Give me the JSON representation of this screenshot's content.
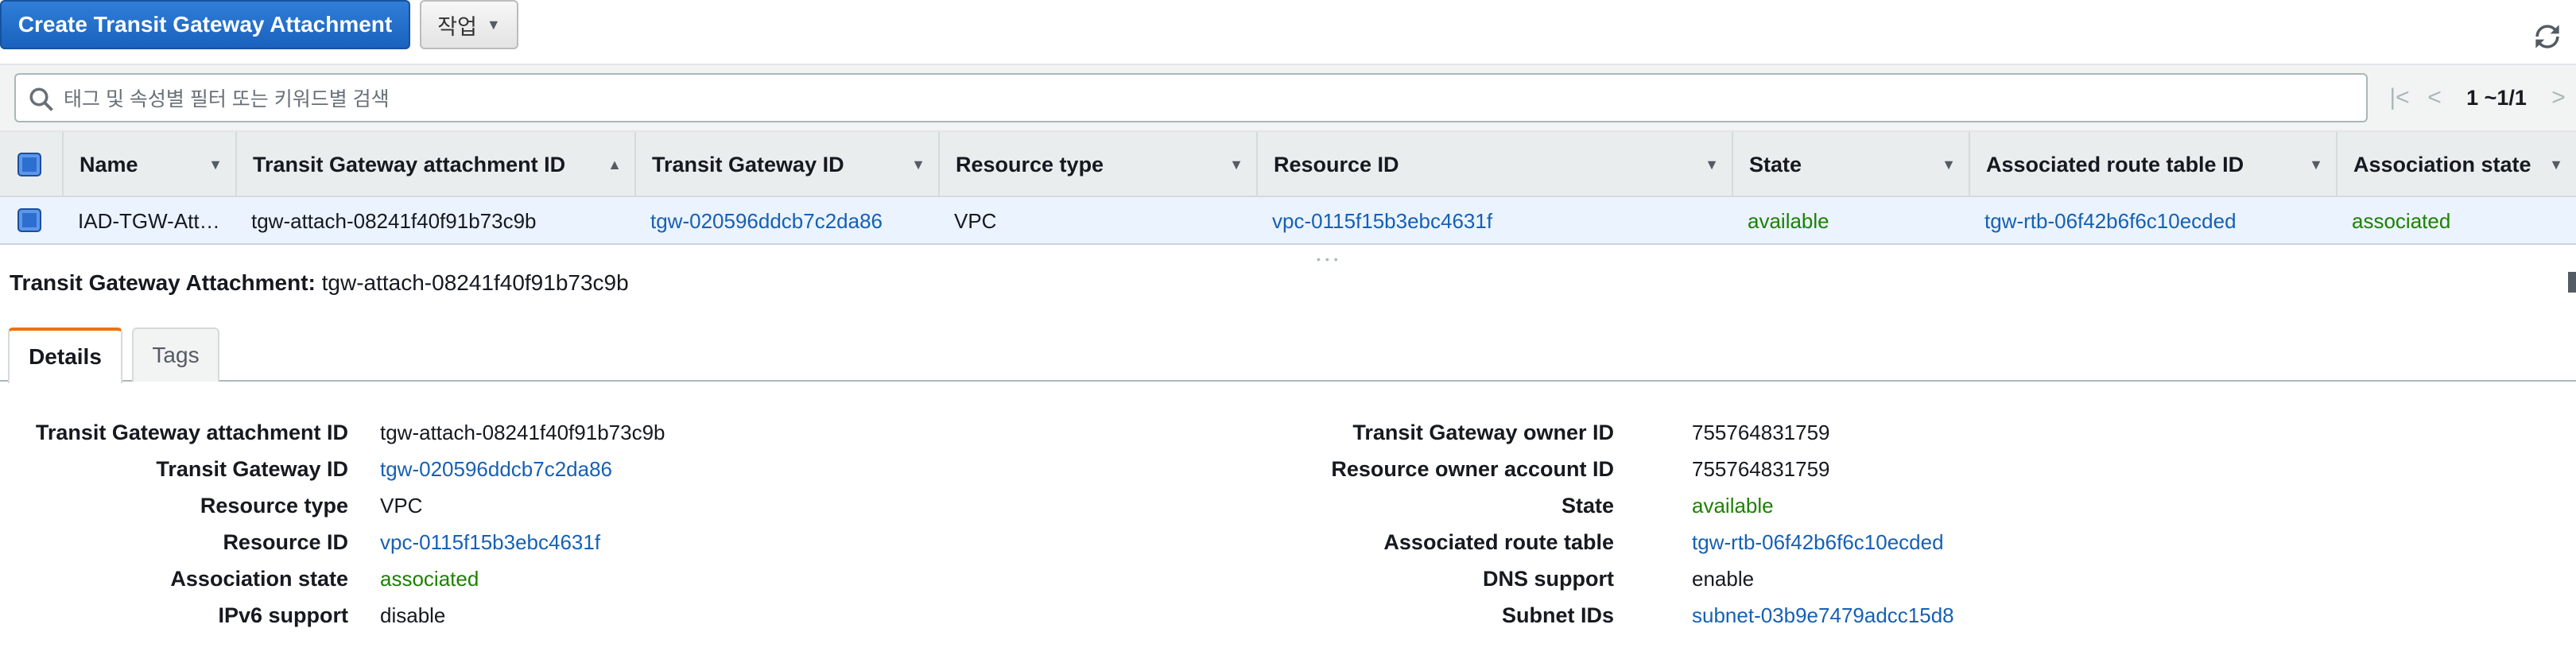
{
  "toolbar": {
    "create_button": "Create Transit Gateway Attachment",
    "actions_button": "작업"
  },
  "search": {
    "placeholder": "태그 및 속성별 필터 또는 키워드별 검색",
    "pagination": "1 ~1/1"
  },
  "table": {
    "columns": [
      "Name",
      "Transit Gateway attachment ID",
      "Transit Gateway ID",
      "Resource type",
      "Resource ID",
      "State",
      "Associated route table ID",
      "Association state"
    ],
    "rows": [
      {
        "name": "IAD-TGW-Att…",
        "attachment_id": "tgw-attach-08241f40f91b73c9b",
        "tgw_id": "tgw-020596ddcb7c2da86",
        "resource_type": "VPC",
        "resource_id": "vpc-0115f15b3ebc4631f",
        "state": "available",
        "route_table_id": "tgw-rtb-06f42b6f6c10ecded",
        "association_state": "associated"
      }
    ]
  },
  "detail": {
    "title_label": "Transit Gateway Attachment:",
    "title_value": "tgw-attach-08241f40f91b73c9b",
    "tabs": [
      "Details",
      "Tags"
    ],
    "left": [
      {
        "label": "Transit Gateway attachment ID",
        "value": "tgw-attach-08241f40f91b73c9b"
      },
      {
        "label": "Transit Gateway ID",
        "value": "tgw-020596ddcb7c2da86"
      },
      {
        "label": "Resource type",
        "value": "VPC"
      },
      {
        "label": "Resource ID",
        "value": "vpc-0115f15b3ebc4631f"
      },
      {
        "label": "Association state",
        "value": "associated"
      },
      {
        "label": "IPv6 support",
        "value": "disable"
      }
    ],
    "right": [
      {
        "label": "Transit Gateway owner ID",
        "value": "755764831759"
      },
      {
        "label": "Resource owner account ID",
        "value": "755764831759"
      },
      {
        "label": "State",
        "value": "available"
      },
      {
        "label": "Associated route table",
        "value": "tgw-rtb-06f42b6f6c10ecded"
      },
      {
        "label": "DNS support",
        "value": "enable"
      },
      {
        "label": "Subnet IDs",
        "value": "subnet-03b9e7479adcc15d8"
      }
    ]
  },
  "colors": {
    "primary": "#1a62bd",
    "link": "#1660b3",
    "status_ok": "#1d8102",
    "tab_accent": "#ec7211"
  },
  "icons": [
    "refresh-icon",
    "search-icon",
    "chevron-down-icon",
    "first-page-icon",
    "prev-page-icon",
    "next-page-icon",
    "sort-asc-icon"
  ]
}
